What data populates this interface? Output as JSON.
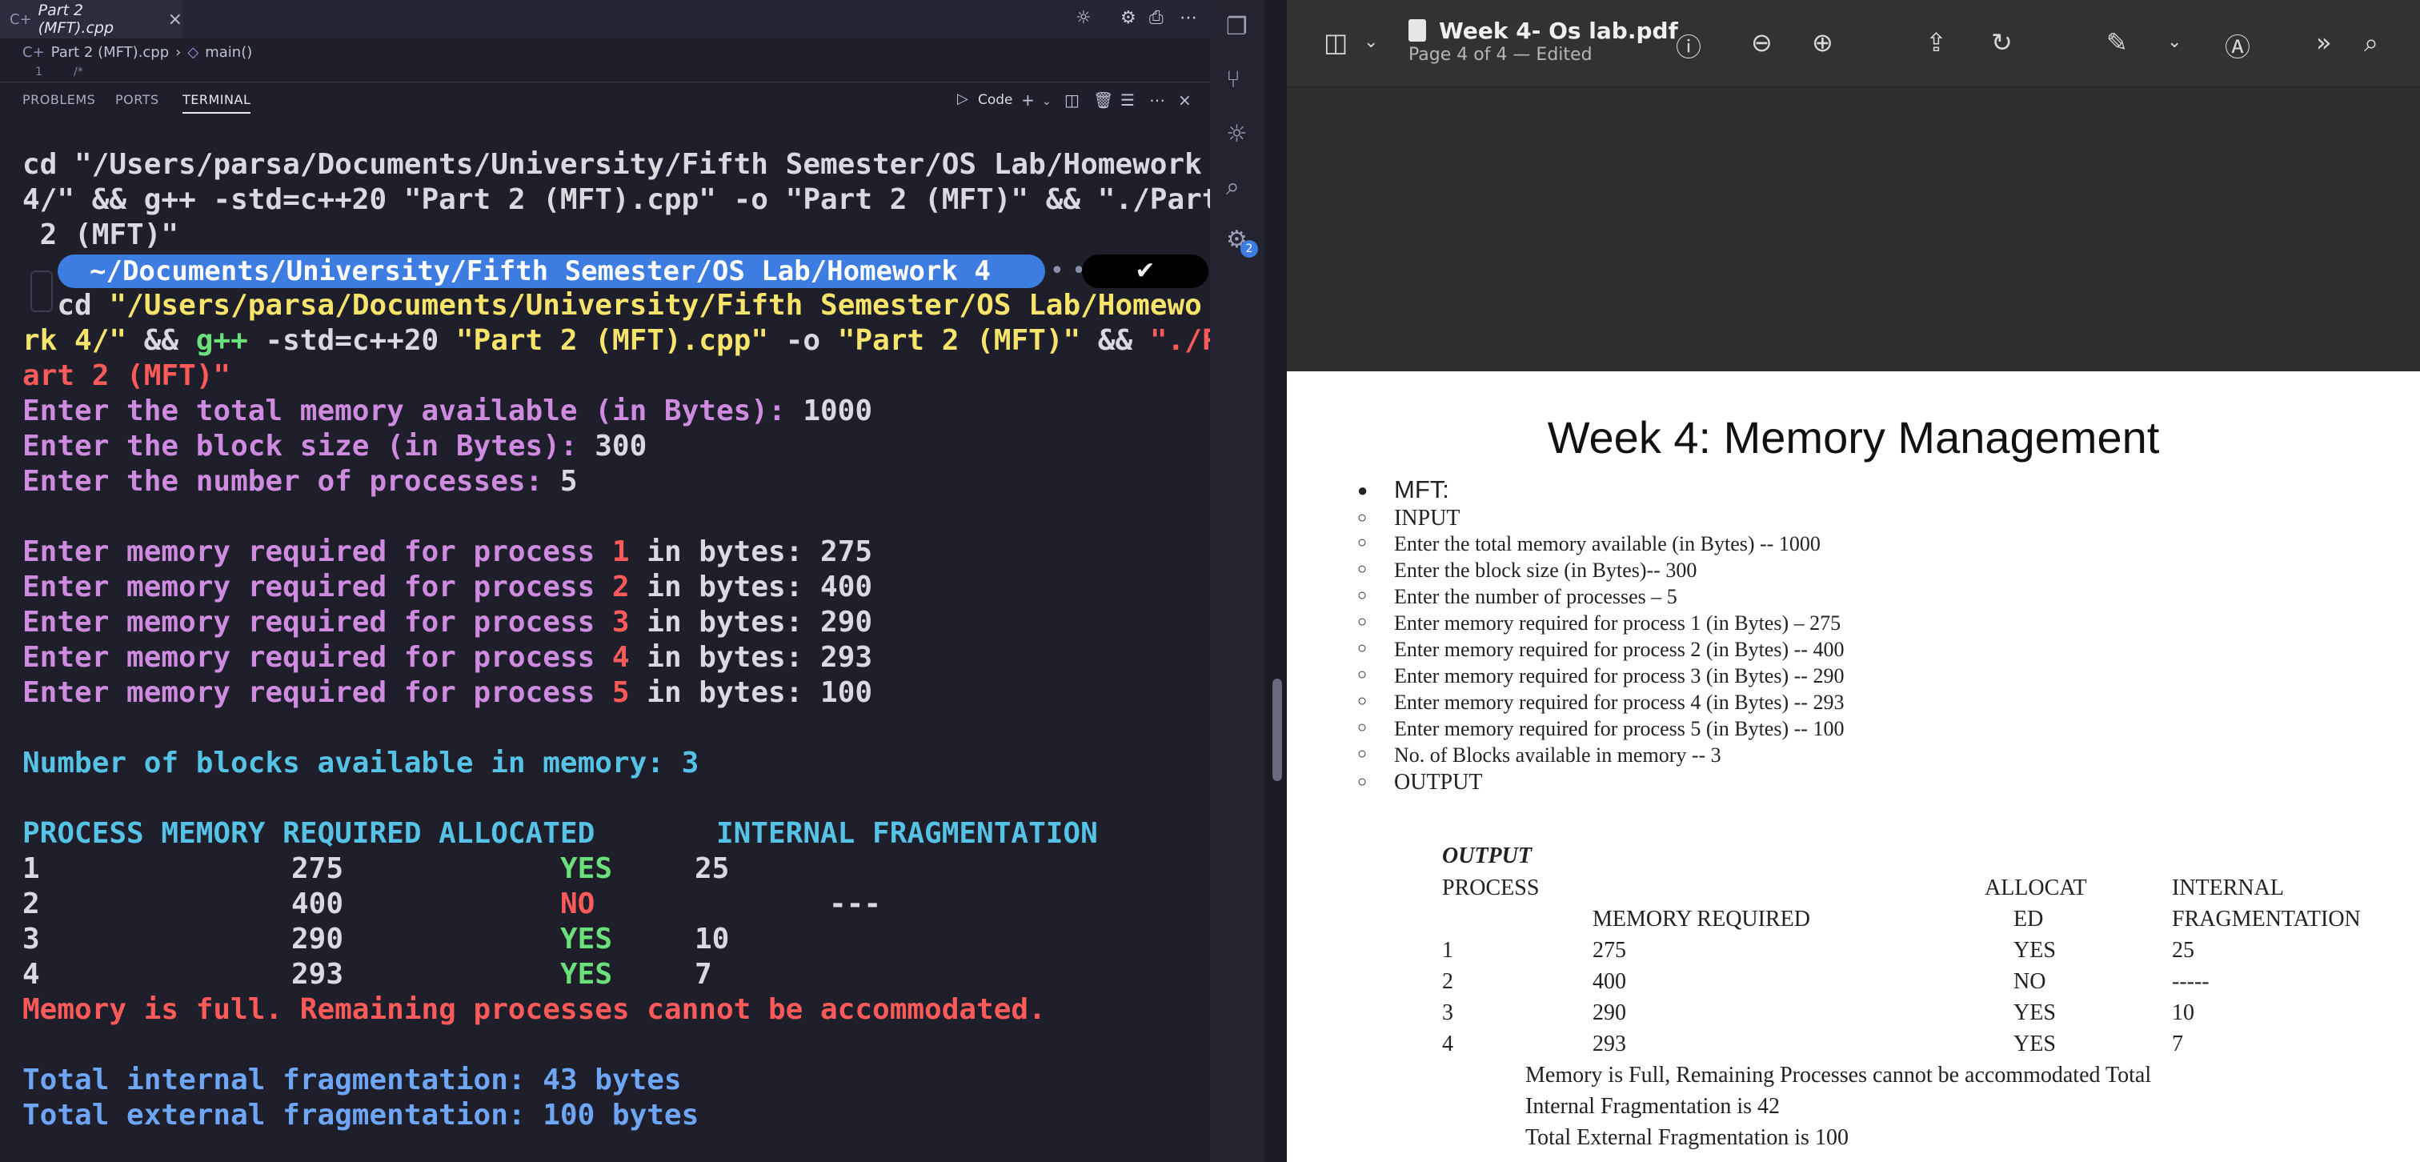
{
  "editor": {
    "tab_title": "Part 2 (MFT).cpp",
    "breadcrumb_file": "Part 2 (MFT).cpp",
    "breadcrumb_symbol": "main()",
    "gutter_line": "1",
    "gutter_text": "/*"
  },
  "panel": {
    "tabs": [
      "PROBLEMS",
      "PORTS",
      "TERMINAL"
    ],
    "shell_label": "Code"
  },
  "terminal": {
    "cmd1": [
      "cd \"/Users/parsa/Documents/University/Fifth Semester/OS Lab/Homework",
      "4/\" && g++ -std=c++20 \"Part 2 (MFT).cpp\" -o \"Part 2 (MFT)\" && \"./Part",
      " 2 (MFT)\""
    ],
    "prompt_path": "~/Documents/University/Fifth Semester/OS Lab/",
    "prompt_dir": "Homework 4",
    "prompt_check": "✔",
    "cmd2_a": "cd ",
    "cmd2_b": "\"/Users/parsa/Documents/University/Fifth Semester/OS Lab/Homewo",
    "cmd2_c": "rk 4/\"",
    "cmd2_d": " && ",
    "cmd2_e": "g++",
    "cmd2_f": " -std=c++20 ",
    "cmd2_g": "\"Part 2 (MFT).cpp\"",
    "cmd2_h": " -o ",
    "cmd2_i": "\"Part 2 (MFT)\"",
    "cmd2_j": " && ",
    "cmd2_k": "\"./P",
    "cmd2_l": "art 2 (MFT)\"",
    "q_total": "Enter the total memory available (in Bytes): ",
    "a_total": "1000",
    "q_block": "Enter the block size (in Bytes): ",
    "a_block": "300",
    "q_count": "Enter the number of processes: ",
    "a_count": "5",
    "proc_prompt_a": "Enter memory required for process ",
    "proc_prompt_b": " in bytes: ",
    "processes": [
      {
        "id": "1",
        "mem": "275"
      },
      {
        "id": "2",
        "mem": "400"
      },
      {
        "id": "3",
        "mem": "290"
      },
      {
        "id": "4",
        "mem": "293"
      },
      {
        "id": "5",
        "mem": "100"
      }
    ],
    "blocks_line": "Number of blocks available in memory: 3",
    "table_header": "PROCESS MEMORY REQUIRED ALLOCATED       INTERNAL FRAGMENTATION",
    "rows": [
      {
        "p": "1",
        "m": "275",
        "a": "YES",
        "f": "25"
      },
      {
        "p": "2",
        "m": "400",
        "a": "NO",
        "f": "---"
      },
      {
        "p": "3",
        "m": "290",
        "a": "YES",
        "f": "10"
      },
      {
        "p": "4",
        "m": "293",
        "a": "YES",
        "f": "7"
      }
    ],
    "full_line": "Memory is full. Remaining processes cannot be accommodated.",
    "internal_line": "Total internal fragmentation: 43 bytes",
    "external_line": "Total external fragmentation: 100 bytes"
  },
  "activity_badge": "2",
  "preview": {
    "title": "Week 4- Os lab.pdf",
    "subtitle": "Page 4 of 4 — Edited",
    "heading": "Week 4: Memory Management",
    "mft_label": "MFT:",
    "items": [
      "INPUT",
      "Enter the total memory available (in Bytes) -- 1000",
      "Enter the block size (in Bytes)-- 300",
      "Enter the number of processes – 5",
      "Enter memory required for process 1 (in Bytes) – 275",
      "Enter memory required for process 2 (in Bytes) -- 400",
      "Enter memory required for process 3 (in Bytes) -- 290",
      "Enter memory required for process 4 (in Bytes) -- 293",
      "Enter memory required for process 5 (in Bytes) -- 100",
      "No. of Blocks available in memory -- 3",
      "OUTPUT"
    ],
    "out_title": "OUTPUT",
    "col_process": "PROCESS",
    "col_alloc_1": "ALLOCAT",
    "col_alloc_2": "ED",
    "col_internal_1": "INTERNAL",
    "col_internal_2": "FRAGMENTATION",
    "col_memory": "MEMORY REQUIRED",
    "rows": [
      {
        "p": "1",
        "m": "275",
        "a": "YES",
        "f": "25"
      },
      {
        "p": "2",
        "m": "400",
        "a": "NO",
        "f": "-----"
      },
      {
        "p": "3",
        "m": "290",
        "a": "YES",
        "f": "10"
      },
      {
        "p": "4",
        "m": "293",
        "a": "YES",
        "f": "7"
      }
    ],
    "summary_1": "Memory is Full, Remaining Processes cannot be accommodated Total",
    "summary_2": "Internal Fragmentation is 42",
    "summary_3": "Total External Fragmentation is 100"
  }
}
